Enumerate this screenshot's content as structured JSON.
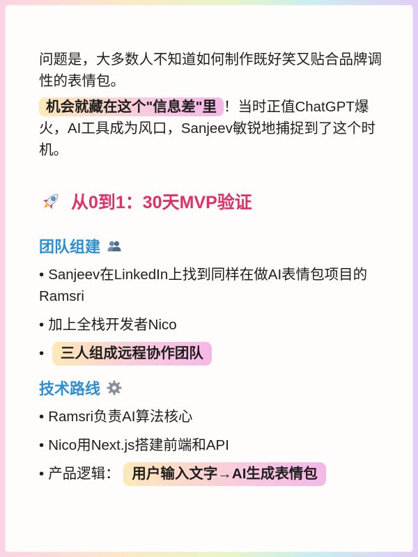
{
  "intro": {
    "para1": "问题是，大多数人不知道如何制作既好笑又贴合品牌调性的表情包。",
    "highlight": "机会就藏在这个\"信息差\"里",
    "para2_rest": "！当时正值ChatGPT爆火，AI工具成为风口，Sanjeev敏锐地捕捉到了这个时机。"
  },
  "section": {
    "icon": "rocket-icon",
    "title": "从0到1：30天MVP验证"
  },
  "team": {
    "title": "团队组建",
    "icon": "people-icon",
    "bullet_char": "•",
    "items": [
      "Sanjeev在LinkedIn上找到同样在做AI表情包项目的Ramsri",
      "加上全栈开发者Nico"
    ],
    "highlight_item": "三人组成远程协作团队"
  },
  "tech": {
    "title": "技术路线",
    "icon": "gear-icon",
    "items": [
      "Ramsri负责AI算法核心",
      "Nico用Next.js搭建前端和API"
    ],
    "product_label": "产品逻辑：",
    "product_highlight": "用户输入文字→AI生成表情包"
  },
  "colors": {
    "section_title": "#e0306a",
    "sub_title": "#2c8fd6",
    "highlight_start": "#fde9b8",
    "highlight_end": "#f5b8e6"
  }
}
